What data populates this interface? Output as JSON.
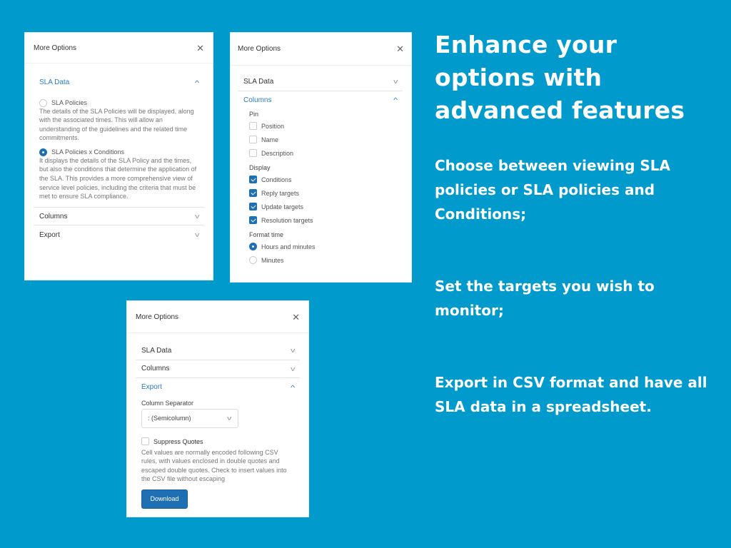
{
  "colors": {
    "background": "#009acd",
    "accent": "#1f6fb5",
    "link": "#2b7cc1"
  },
  "panel1": {
    "title": "More Options",
    "close_icon": "✕",
    "sla_data": {
      "label": "SLA Data",
      "options": [
        {
          "label": "SLA Policies",
          "selected": false,
          "description": "The details of the SLA Policies will be displayed, along with the associated times. This will allow an understanding of the guidelines and the related time commitments."
        },
        {
          "label": "SLA Policies x Conditions",
          "selected": true,
          "description": "It displays the details of the SLA Policy and the times, but also the conditions that determine the application of the SLA. This provides a more comprehensive view of service level policies, including the criteria that must be met to ensure SLA compliance."
        }
      ]
    },
    "columns_label": "Columns",
    "export_label": "Export"
  },
  "panel2": {
    "title": "More Options",
    "close_icon": "✕",
    "sla_data_label": "SLA Data",
    "columns_label": "Columns",
    "pin": {
      "label": "Pin",
      "items": [
        {
          "label": "Position",
          "checked": false
        },
        {
          "label": "Name",
          "checked": false
        },
        {
          "label": "Description",
          "checked": false
        }
      ]
    },
    "display": {
      "label": "Display",
      "items": [
        {
          "label": "Conditions",
          "checked": true
        },
        {
          "label": "Reply targets",
          "checked": true
        },
        {
          "label": "Update targets",
          "checked": true
        },
        {
          "label": "Resolution targets",
          "checked": true
        }
      ]
    },
    "format_time": {
      "label": "Format time",
      "items": [
        {
          "label": "Hours and minutes",
          "selected": true
        },
        {
          "label": "Minutes",
          "selected": false
        }
      ]
    }
  },
  "panel3": {
    "title": "More Options",
    "close_icon": "✕",
    "sla_data_label": "SLA Data",
    "columns_label": "Columns",
    "export_label": "Export",
    "separator_label": "Column Separator",
    "separator_value": ": (Semicolumn)",
    "suppress_label": "Suppress Quotes",
    "suppress_checked": false,
    "suppress_description": "Cell values are normally encoded following CSV rules, with values enclosed in double quotes and escaped double quotes. Check to insert values into the CSV file without escaping",
    "download_label": "Download"
  },
  "marketing": {
    "headline": "Enhance your options with advanced features",
    "points": [
      "Choose between viewing SLA policies or SLA policies and Conditions;",
      "Set the targets you wish to monitor;",
      "Export in CSV format and have all SLA data in a spreadsheet."
    ]
  }
}
